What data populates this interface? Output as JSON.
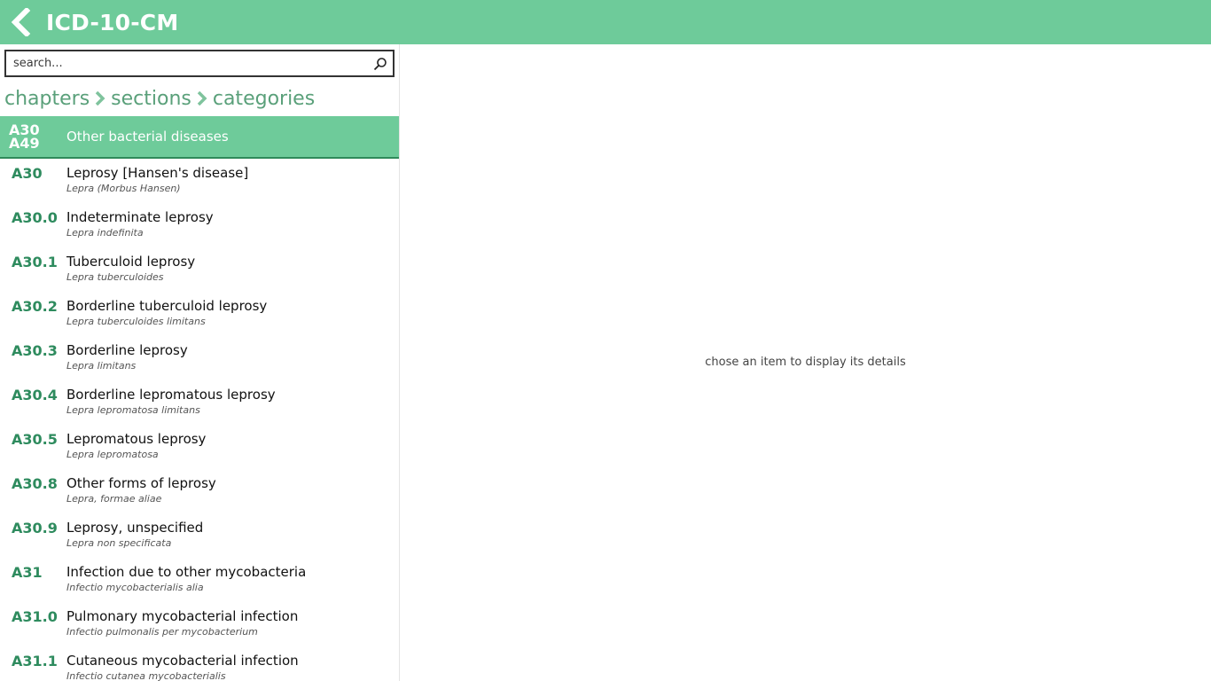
{
  "app": {
    "title": "ICD-10-CM",
    "accent_color": "#6ecb9a",
    "code_color": "#2e8b5e"
  },
  "header": {
    "back_icon": "back-chevron-icon"
  },
  "search": {
    "placeholder": "search...",
    "value": "",
    "icon": "search-icon"
  },
  "breadcrumb": {
    "items": [
      {
        "label": "chapters"
      },
      {
        "label": "sections"
      },
      {
        "label": "categories"
      }
    ],
    "separator_icon": "chevron-right-icon"
  },
  "selected_section": {
    "code_line1": "A30",
    "code_line2": "A49",
    "title": "Other bacterial diseases"
  },
  "categories": [
    {
      "code": "A30",
      "title": "Leprosy [Hansen's disease]",
      "latin": "Lepra (Morbus Hansen)"
    },
    {
      "code": "A30.0",
      "title": "Indeterminate leprosy",
      "latin": "Lepra indefinita"
    },
    {
      "code": "A30.1",
      "title": "Tuberculoid leprosy",
      "latin": "Lepra tuberculoides"
    },
    {
      "code": "A30.2",
      "title": "Borderline tuberculoid leprosy",
      "latin": "Lepra tuberculoides limitans"
    },
    {
      "code": "A30.3",
      "title": "Borderline leprosy",
      "latin": "Lepra limitans"
    },
    {
      "code": "A30.4",
      "title": "Borderline lepromatous leprosy",
      "latin": "Lepra lepromatosa limitans"
    },
    {
      "code": "A30.5",
      "title": "Lepromatous leprosy",
      "latin": "Lepra lepromatosa"
    },
    {
      "code": "A30.8",
      "title": "Other forms of leprosy",
      "latin": "Lepra, formae aliae"
    },
    {
      "code": "A30.9",
      "title": "Leprosy, unspecified",
      "latin": "Lepra non specificata"
    },
    {
      "code": "A31",
      "title": "Infection due to other mycobacteria",
      "latin": "Infectio mycobacterialis alia"
    },
    {
      "code": "A31.0",
      "title": "Pulmonary mycobacterial infection",
      "latin": "Infectio pulmonalis per mycobacterium"
    },
    {
      "code": "A31.1",
      "title": "Cutaneous mycobacterial infection",
      "latin": "Infectio cutanea mycobacterialis"
    }
  ],
  "detail": {
    "empty_message": "chose an item to display its details"
  }
}
